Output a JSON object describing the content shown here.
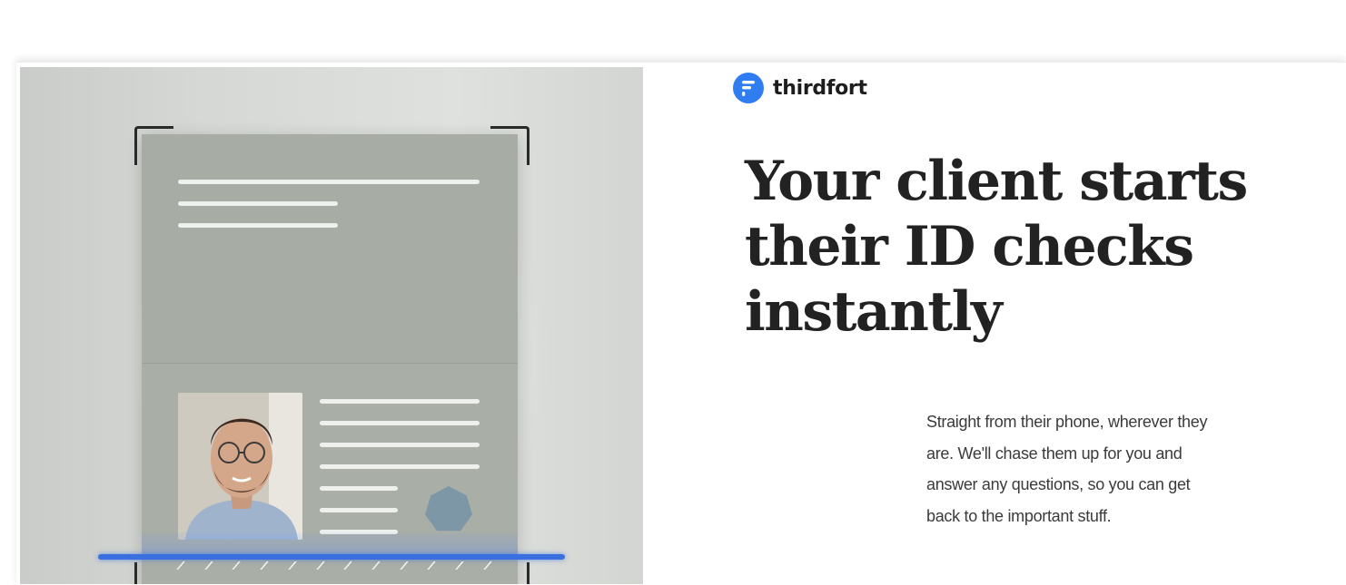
{
  "brand": {
    "name": "thirdfort",
    "color": "#2f7df0"
  },
  "hero": {
    "headline": "Your client starts their ID checks instantly",
    "body": "Straight from their phone, wherever they are. We'll chase them up for you and answer any questions, so you can get back to the important stuff."
  },
  "illustration": {
    "icons": [
      "id-document-icon",
      "scan-frame-icon",
      "scan-line-icon",
      "holographic-seal-icon",
      "portrait-photo"
    ],
    "scan_color": "#3a6fe0"
  }
}
